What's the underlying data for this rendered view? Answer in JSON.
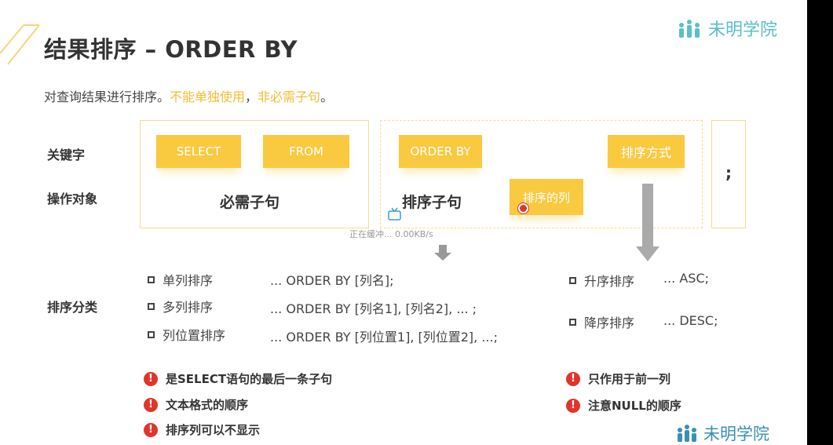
{
  "title": "结果排序 – ORDER BY",
  "subtitle": {
    "lead": "对查询结果进行排序。",
    "highlight1": "不能单独使用",
    "comma": "，",
    "highlight2": "非必需子句",
    "end": "。"
  },
  "logo": {
    "text": "未明学院"
  },
  "rows": {
    "keyword": "关键字",
    "operand": "操作对象",
    "categories": "排序分类"
  },
  "chips": {
    "select": "SELECT",
    "from": "FROM",
    "order_by": "ORDER BY",
    "sort_col": "排序的列",
    "sort_way": "排序方式"
  },
  "clauses": {
    "required": "必需子句",
    "sort": "排序子句",
    "semicolon": ";"
  },
  "network_status": "正在缓冲... 0.00KB/s",
  "sort_types": [
    {
      "name": "单列排序",
      "syntax": "... ORDER BY [列名];"
    },
    {
      "name": "多列排序",
      "syntax": "... ORDER BY [列名1], [列名2], ... ;"
    },
    {
      "name": "列位置排序",
      "syntax": "... ORDER BY [列位置1], [列位置2], ...;"
    }
  ],
  "orders": [
    {
      "name": "升序排序",
      "syntax": "... ASC;"
    },
    {
      "name": "降序排序",
      "syntax": "... DESC;"
    }
  ],
  "notes_left": [
    "是SELECT语句的最后一条子句",
    "文本格式的顺序",
    "排序列可以不显示"
  ],
  "notes_right": [
    "只作用于前一列",
    "注意NULL的顺序"
  ],
  "colors": {
    "accent": "#f9c940",
    "highlight": "#f2bd34",
    "warning": "#e0352b",
    "logo": "#5bbfc7"
  }
}
